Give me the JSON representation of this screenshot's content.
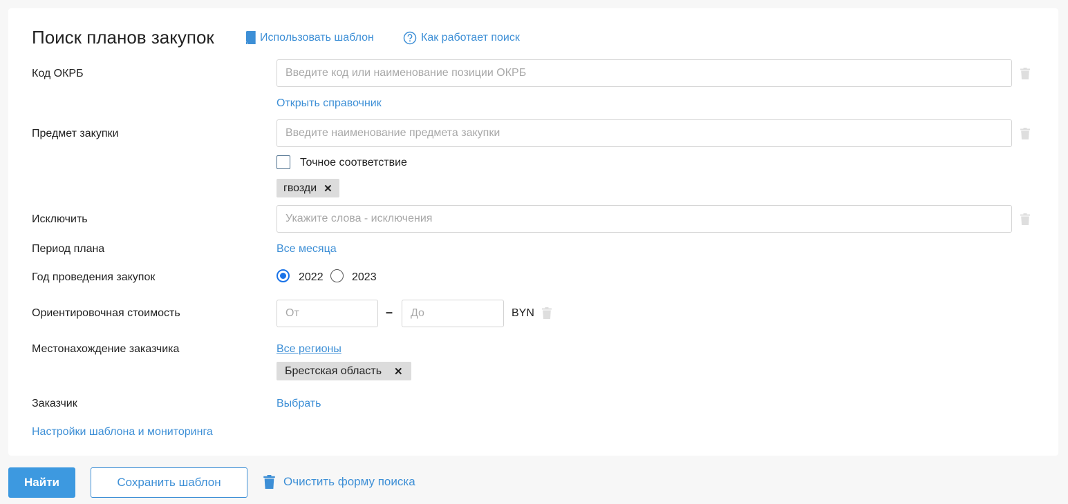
{
  "header": {
    "title": "Поиск планов закупок",
    "use_template": "Использовать шаблон",
    "how_search_works": "Как работает поиск"
  },
  "okrb": {
    "label": "Код ОКРБ",
    "placeholder": "Введите код или наименование позиции ОКРБ",
    "open_directory": "Открыть справочник"
  },
  "subject": {
    "label": "Предмет закупки",
    "placeholder": "Введите наименование предмета закупки",
    "exact_match": "Точное соответствие",
    "exact_match_checked": false,
    "tags": [
      "гвозди"
    ]
  },
  "exclude": {
    "label": "Исключить",
    "placeholder": "Укажите слова - исключения"
  },
  "period": {
    "label": "Период плана",
    "value": "Все месяца"
  },
  "year": {
    "label": "Год проведения закупок",
    "options": [
      "2022",
      "2023"
    ],
    "selected": "2022"
  },
  "cost": {
    "label": "Ориентировочная стоимость",
    "from_placeholder": "От",
    "to_placeholder": "До",
    "dash": "–",
    "currency": "BYN"
  },
  "location": {
    "label": "Местонахождение заказчика",
    "all_regions": "Все регионы",
    "tags": [
      "Брестская область"
    ]
  },
  "customer": {
    "label": "Заказчик",
    "choose": "Выбрать"
  },
  "template_settings": "Настройки шаблона и мониторинга",
  "actions": {
    "find": "Найти",
    "save_template": "Сохранить шаблон",
    "clear_form": "Очистить форму поиска"
  },
  "colors": {
    "accent": "#3d8fd6",
    "primary_button": "#3d99e0",
    "radio_selected": "#1a73e8",
    "tag_bg": "#dcdcdc",
    "trash_icon": "#dedede"
  }
}
